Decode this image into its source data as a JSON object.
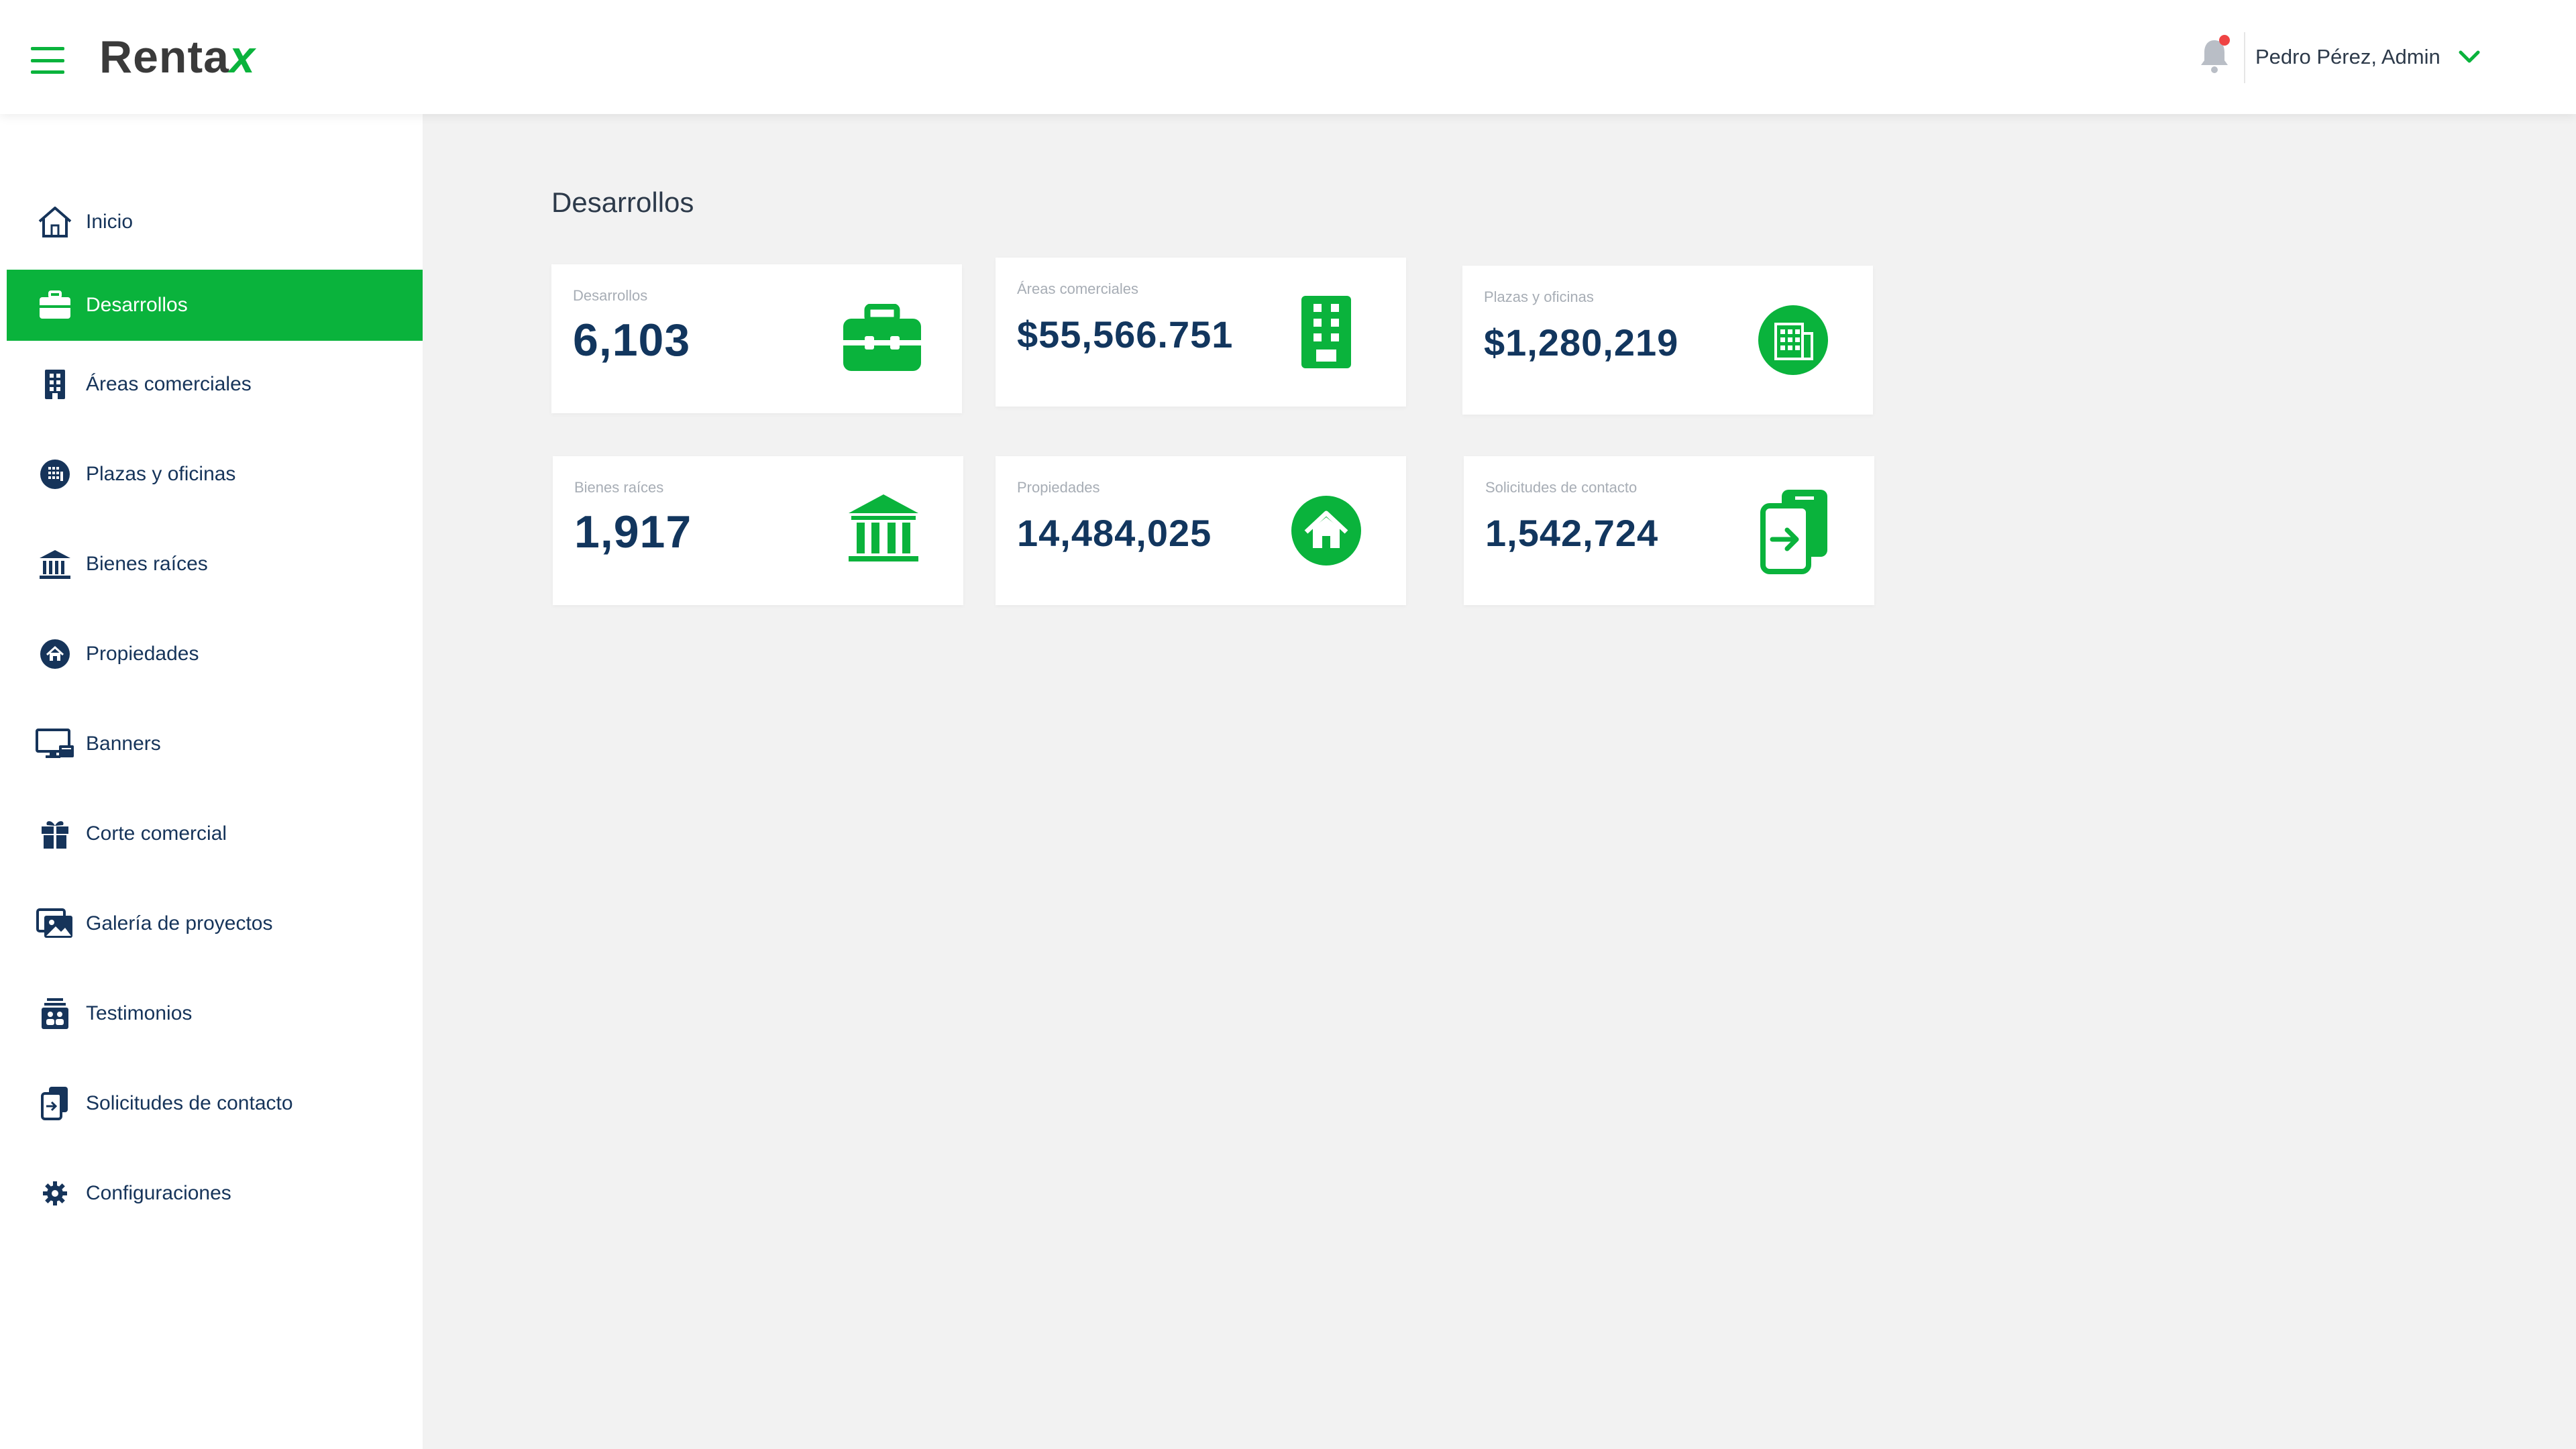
{
  "header": {
    "logo_main": "Renta",
    "logo_accent": "x",
    "user_name": "Pedro Pérez, Admin",
    "accent_color": "#0ab33c",
    "notification_dot_color": "#ef4444"
  },
  "sidebar": {
    "items": [
      {
        "label": "Inicio",
        "icon": "home-icon",
        "active": false
      },
      {
        "label": "Desarrollos",
        "icon": "briefcase-icon",
        "active": true
      },
      {
        "label": "Áreas comerciales",
        "icon": "building-icon",
        "active": false
      },
      {
        "label": "Plazas y oficinas",
        "icon": "office-icon",
        "active": false
      },
      {
        "label": "Bienes raíces",
        "icon": "bank-icon",
        "active": false
      },
      {
        "label": "Propiedades",
        "icon": "house-circle-icon",
        "active": false
      },
      {
        "label": "Banners",
        "icon": "monitor-icon",
        "active": false
      },
      {
        "label": "Corte comercial",
        "icon": "gift-icon",
        "active": false
      },
      {
        "label": "Galería de proyectos",
        "icon": "gallery-icon",
        "active": false
      },
      {
        "label": "Testimonios",
        "icon": "testimonial-icon",
        "active": false
      },
      {
        "label": "Solicitudes de contacto",
        "icon": "contact-request-icon",
        "active": false
      },
      {
        "label": "Configuraciones",
        "icon": "gear-icon",
        "active": false
      }
    ]
  },
  "main": {
    "title": "Desarrollos",
    "cards": [
      {
        "label": "Desarrollos",
        "value": "6,103",
        "icon": "briefcase-icon"
      },
      {
        "label": "Áreas comerciales",
        "value": "$55,566.751",
        "icon": "building-icon"
      },
      {
        "label": "Plazas y oficinas",
        "value": "$1,280,219",
        "icon": "office-icon"
      },
      {
        "label": "Bienes raíces",
        "value": "1,917",
        "icon": "bank-icon"
      },
      {
        "label": "Propiedades",
        "value": "14,484,025",
        "icon": "house-circle-icon"
      },
      {
        "label": "Solicitudes de contacto",
        "value": "1,542,724",
        "icon": "contact-request-icon"
      }
    ]
  }
}
